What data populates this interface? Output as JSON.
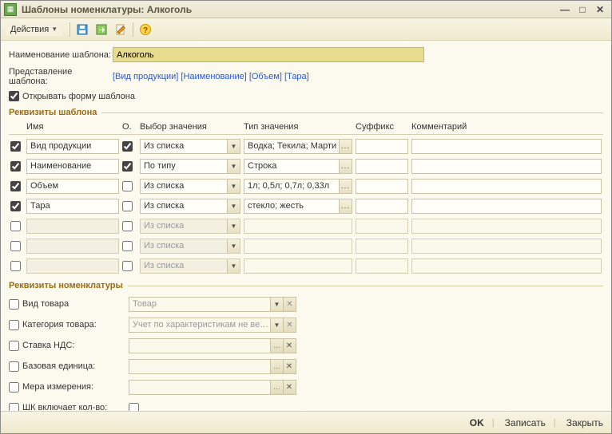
{
  "window": {
    "title": "Шаблоны номенклатуры: Алкоголь"
  },
  "toolbar": {
    "actions_label": "Действия"
  },
  "form": {
    "name_label": "Наименование шаблона:",
    "name_value": "Алкоголь",
    "repr_label": "Представление шаблона:",
    "repr_value": "[Вид продукции] [Наименование] [Объем] [Тара]",
    "open_form_label": "Открывать форму шаблона"
  },
  "section1_title": "Реквизиты шаблона",
  "grid": {
    "headers": {
      "name": "Имя",
      "o": "О.",
      "sel": "Выбор значения",
      "type": "Тип значения",
      "suf": "Суффикс",
      "com": "Комментарий"
    },
    "rows": [
      {
        "enabled": true,
        "name": "Вид продукции",
        "o": true,
        "sel": "Из списка",
        "type": "Водка; Текила; Марти",
        "suf": "",
        "com": ""
      },
      {
        "enabled": true,
        "name": "Наименование",
        "o": true,
        "sel": "По типу",
        "type": "Строка",
        "suf": "",
        "com": ""
      },
      {
        "enabled": true,
        "name": "Объем",
        "o": false,
        "sel": "Из списка",
        "type": "1л; 0,5л; 0,7л; 0,33л",
        "suf": "",
        "com": ""
      },
      {
        "enabled": true,
        "name": "Тара",
        "o": false,
        "sel": "Из списка",
        "type": "стекло; жесть",
        "suf": "",
        "com": ""
      },
      {
        "enabled": false,
        "name": "",
        "o": false,
        "sel": "Из списка",
        "type": "",
        "suf": "",
        "com": ""
      },
      {
        "enabled": false,
        "name": "",
        "o": false,
        "sel": "Из списка",
        "type": "",
        "suf": "",
        "com": ""
      },
      {
        "enabled": false,
        "name": "",
        "o": false,
        "sel": "Из списка",
        "type": "",
        "suf": "",
        "com": ""
      }
    ]
  },
  "section2_title": "Реквизиты номенклатуры",
  "nom": {
    "rows": [
      {
        "key": "product-type",
        "checked": false,
        "label": "Вид товара",
        "value": "Товар",
        "kind": "dropdown"
      },
      {
        "key": "product-category",
        "checked": false,
        "label": "Категория товара:",
        "value": "Учет по характеристикам не ведется",
        "kind": "dropdown"
      },
      {
        "key": "vat-rate",
        "checked": false,
        "label": "Ставка НДС:",
        "value": "",
        "kind": "more"
      },
      {
        "key": "base-unit",
        "checked": false,
        "label": "Базовая единица:",
        "value": "",
        "kind": "more"
      },
      {
        "key": "measure",
        "checked": false,
        "label": "Мера измерения:",
        "value": "",
        "kind": "more"
      },
      {
        "key": "bc-includes-qty",
        "checked": false,
        "label": "ШК включает кол-во:",
        "value": "",
        "kind": "checkbox-only"
      }
    ]
  },
  "buttons": {
    "ok": "OK",
    "save": "Записать",
    "close": "Закрыть"
  }
}
